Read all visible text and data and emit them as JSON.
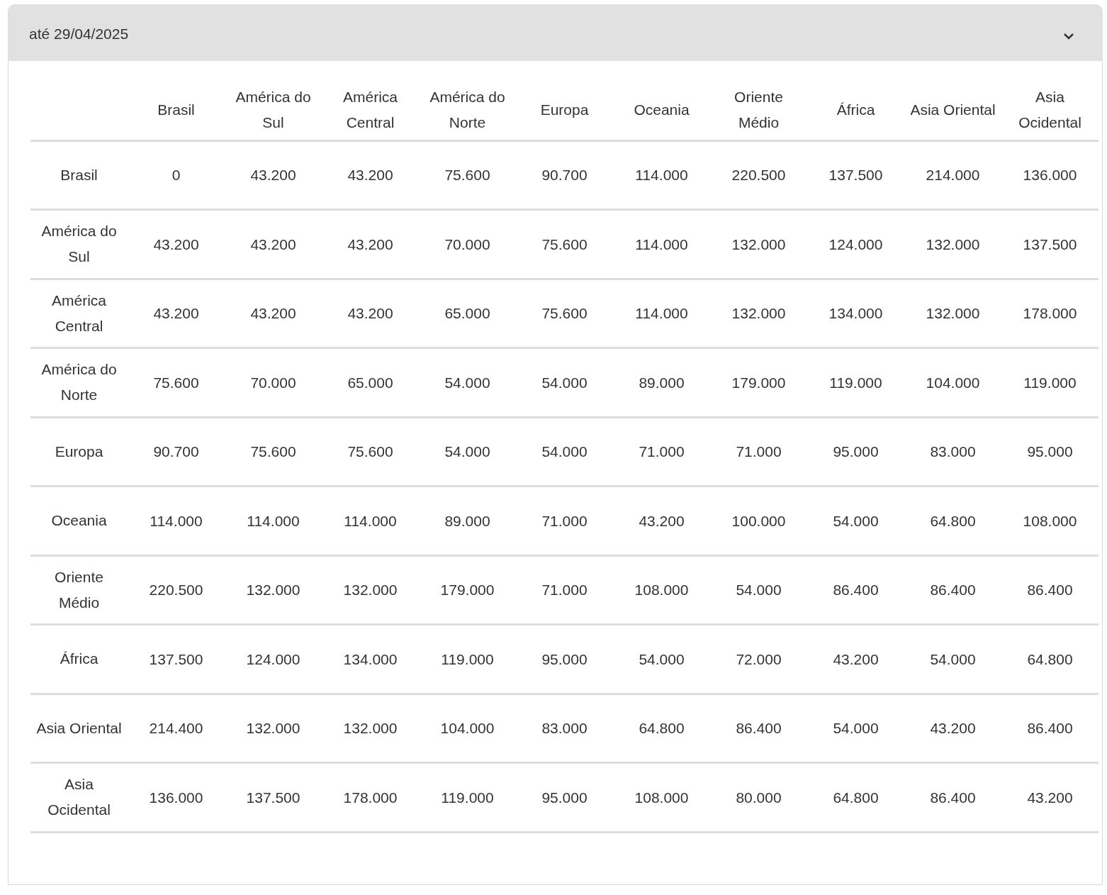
{
  "accordion": {
    "title": "até 29/04/2025",
    "expanded": true
  },
  "table": {
    "columns": [
      "Brasil",
      "América do Sul",
      "América Central",
      "América do Norte",
      "Europa",
      "Oceania",
      "Oriente Médio",
      "África",
      "Asia Oriental",
      "Asia Ocidental"
    ],
    "rows": [
      {
        "label": "Brasil",
        "cells": [
          "0",
          "43.200",
          "43.200",
          "75.600",
          "90.700",
          "114.000",
          "220.500",
          "137.500",
          "214.000",
          "136.000"
        ]
      },
      {
        "label": "América do Sul",
        "cells": [
          "43.200",
          "43.200",
          "43.200",
          "70.000",
          "75.600",
          "114.000",
          "132.000",
          "124.000",
          "132.000",
          "137.500"
        ]
      },
      {
        "label": "América Central",
        "cells": [
          "43.200",
          "43.200",
          "43.200",
          "65.000",
          "75.600",
          "114.000",
          "132.000",
          "134.000",
          "132.000",
          "178.000"
        ]
      },
      {
        "label": "América do Norte",
        "cells": [
          "75.600",
          "70.000",
          "65.000",
          "54.000",
          "54.000",
          "89.000",
          "179.000",
          "119.000",
          "104.000",
          "119.000"
        ]
      },
      {
        "label": "Europa",
        "cells": [
          "90.700",
          "75.600",
          "75.600",
          "54.000",
          "54.000",
          "71.000",
          "71.000",
          "95.000",
          "83.000",
          "95.000"
        ]
      },
      {
        "label": "Oceania",
        "cells": [
          "114.000",
          "114.000",
          "114.000",
          "89.000",
          "71.000",
          "43.200",
          "100.000",
          "54.000",
          "64.800",
          "108.000"
        ]
      },
      {
        "label": "Oriente Médio",
        "cells": [
          "220.500",
          "132.000",
          "132.000",
          "179.000",
          "71.000",
          "108.000",
          "54.000",
          "86.400",
          "86.400",
          "86.400"
        ]
      },
      {
        "label": "África",
        "cells": [
          "137.500",
          "124.000",
          "134.000",
          "119.000",
          "95.000",
          "54.000",
          "72.000",
          "43.200",
          "54.000",
          "64.800"
        ]
      },
      {
        "label": "Asia Oriental",
        "cells": [
          "214.400",
          "132.000",
          "132.000",
          "104.000",
          "83.000",
          "64.800",
          "86.400",
          "54.000",
          "43.200",
          "86.400"
        ]
      },
      {
        "label": "Asia Ocidental",
        "cells": [
          "136.000",
          "137.500",
          "178.000",
          "119.000",
          "95.000",
          "108.000",
          "80.000",
          "64.800",
          "86.400",
          "43.200"
        ]
      }
    ]
  }
}
